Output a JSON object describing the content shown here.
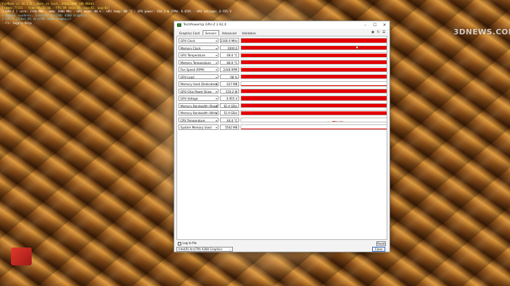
{
  "overlay": {
    "lines": [
      "FurMark v1.38.1.0 - Burn-in test, 1920x1080 (0X MSAA)",
      "Frames:77151 - time:00:12:56 - FPS:99 (min:65, max:93, avg:82)",
      "[ GPU-Z ] core: 2160 MHz - mem: 2000 MHz - GPU load: 98 % - GPU temp: 69 °C - GPU power: 150.2 W (PPW: 0.659) - GPU voltage: 0.955 V",
      "> OpenGL renderer: Intel(R) Arc(TM) A380 Graphics",
      "> GPU 1 (Intel(R) Arc(TM) A380 Graphics)",
      "- F1: toggle help"
    ]
  },
  "watermark": "3DNEWS.COM",
  "window": {
    "title": "TechPowerUp GPU-Z 2.62.0",
    "controls": [
      "–",
      "☐",
      "✕"
    ],
    "tabs": [
      {
        "label": "Graphics Card",
        "active": false
      },
      {
        "label": "Sensors",
        "active": true
      },
      {
        "label": "Advanced",
        "active": false
      },
      {
        "label": "Validation",
        "active": false
      }
    ],
    "toolbar_icons": [
      "camera-icon",
      "refresh-icon",
      "menu-icon"
    ]
  },
  "sensors": [
    {
      "label": "GPU Clock",
      "value": "2160.0 MHz",
      "fill": 1.0
    },
    {
      "label": "Memory Clock",
      "value": "2000.0",
      "fill": 1.0
    },
    {
      "label": "GPU Temperature",
      "value": "69.0 °C",
      "fill": 0.85
    },
    {
      "label": "Memory Temperature",
      "value": "80.0 °C",
      "fill": 0.85
    },
    {
      "label": "Fan Speed (RPM)",
      "value": "2248 RPM",
      "fill": 0.8
    },
    {
      "label": "GPU Load",
      "value": "98 %",
      "fill": 0.98
    },
    {
      "label": "Memory Used (Dedicated)",
      "value": "627 MB",
      "fill": 0.15
    },
    {
      "label": "GPU Chip Power Draw",
      "value": "150.2 W",
      "fill": 0.9
    },
    {
      "label": "GPU Voltage",
      "value": "0.955 V",
      "fill": 0.92
    },
    {
      "label": "Memory Bandwidth (Read)",
      "value": "62.4 GB/s",
      "fill": 0.88
    },
    {
      "label": "Memory Bandwidth (Write)",
      "value": "52.9 GB/s",
      "fill": 0.88
    },
    {
      "label": "CPU Temperature",
      "value": "44.4 °C",
      "fill": 0.05
    },
    {
      "label": "System Memory Used",
      "value": "5562 MB",
      "fill": 0.05
    }
  ],
  "log_label": "Log to file",
  "reset_label": "Reset",
  "gpu_select": "Intel(R) Arc(TM) A380 Graphics",
  "close_label": "Close",
  "colors": {
    "graph_fill": "#e30000",
    "accent": "#2a62c0"
  }
}
